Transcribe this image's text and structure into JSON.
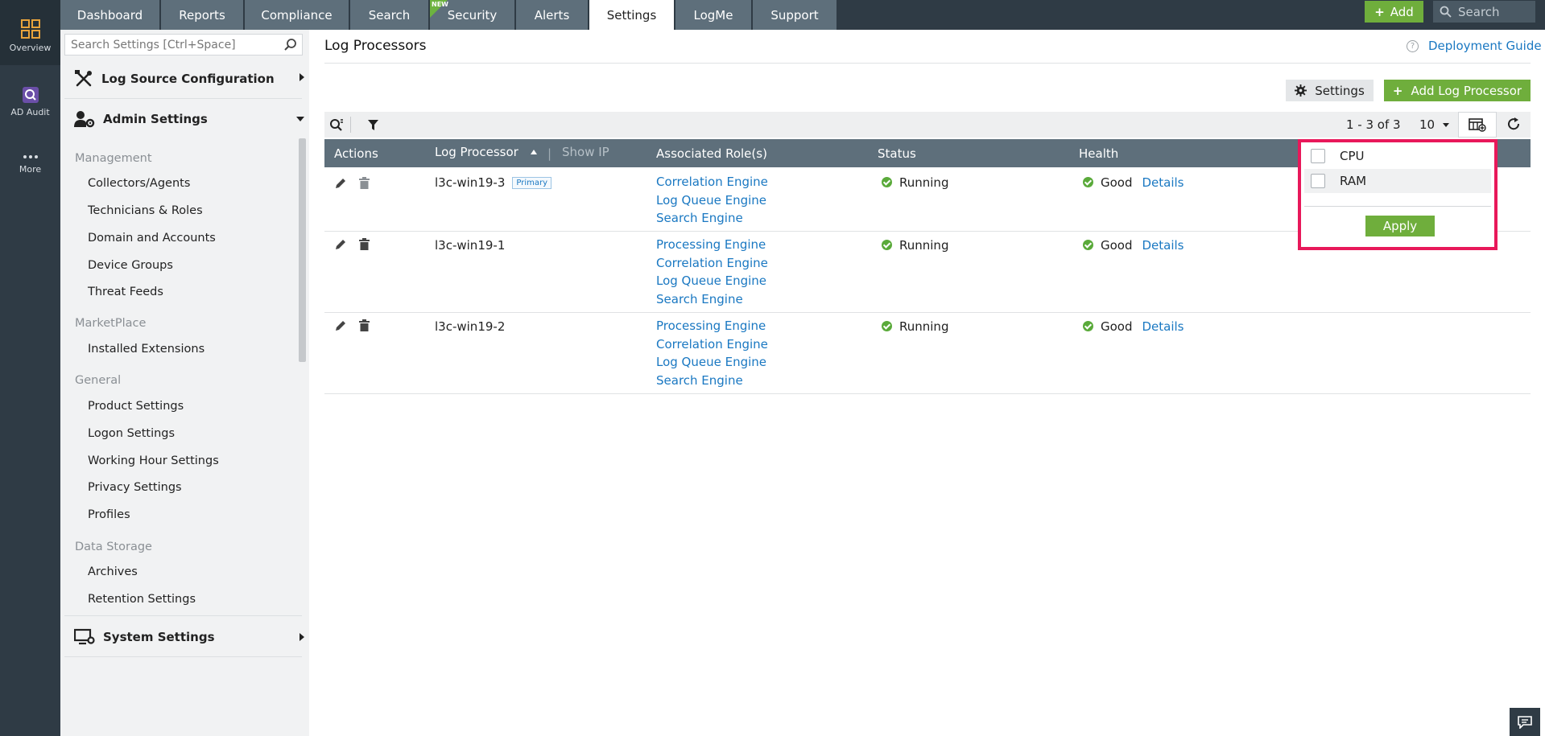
{
  "rail": {
    "overview": "Overview",
    "ad_audit": "AD Audit",
    "more": "More"
  },
  "tabs": [
    "Dashboard",
    "Reports",
    "Compliance",
    "Search",
    "Security",
    "Alerts",
    "Settings",
    "LogMe",
    "Support"
  ],
  "new_flag": "NEW",
  "topbar": {
    "add_label": "Add",
    "search_placeholder": "Search"
  },
  "sidebar": {
    "search_placeholder": "Search Settings [Ctrl+Space]",
    "log_source": "Log Source Configuration",
    "admin_settings": "Admin Settings",
    "system_settings": "System Settings",
    "groups": {
      "management": "Management",
      "marketplace": "MarketPlace",
      "general": "General",
      "data_storage": "Data Storage"
    },
    "items": {
      "collectors": "Collectors/Agents",
      "technicians": "Technicians & Roles",
      "domain": "Domain and Accounts",
      "device_groups": "Device Groups",
      "threat_feeds": "Threat Feeds",
      "installed_ext": "Installed Extensions",
      "product_settings": "Product Settings",
      "logon_settings": "Logon Settings",
      "working_hour": "Working Hour Settings",
      "privacy": "Privacy Settings",
      "profiles": "Profiles",
      "archives": "Archives",
      "retention": "Retention Settings"
    }
  },
  "page": {
    "title": "Log Processors",
    "guide": "Deployment Guide",
    "settings_btn": "Settings",
    "add_btn": "Add Log Processor",
    "pager": "1 - 3 of 3",
    "per_page": "10"
  },
  "table": {
    "headers": {
      "actions": "Actions",
      "log_processor": "Log Processor",
      "show_ip": "Show IP",
      "roles": "Associated Role(s)",
      "status": "Status",
      "health": "Health"
    },
    "rows": [
      {
        "name": "l3c-win19-3",
        "badge": "Primary",
        "roles": [
          "Correlation Engine",
          "Log Queue Engine",
          "Search Engine"
        ],
        "status": "Running",
        "health": "Good",
        "details": "Details"
      },
      {
        "name": "l3c-win19-1",
        "badge": "",
        "roles": [
          "Processing Engine",
          "Correlation Engine",
          "Log Queue Engine",
          "Search Engine"
        ],
        "status": "Running",
        "health": "Good",
        "details": "Details"
      },
      {
        "name": "l3c-win19-2",
        "badge": "",
        "roles": [
          "Processing Engine",
          "Correlation Engine",
          "Log Queue Engine",
          "Search Engine"
        ],
        "status": "Running",
        "health": "Good",
        "details": "Details"
      }
    ]
  },
  "column_popup": {
    "options": [
      "CPU",
      "RAM"
    ],
    "apply": "Apply"
  },
  "colors": {
    "accent_green": "#6fae3c",
    "link_blue": "#1a78c2",
    "highlight": "#e8185a",
    "nav_dark": "#2f3b45"
  }
}
